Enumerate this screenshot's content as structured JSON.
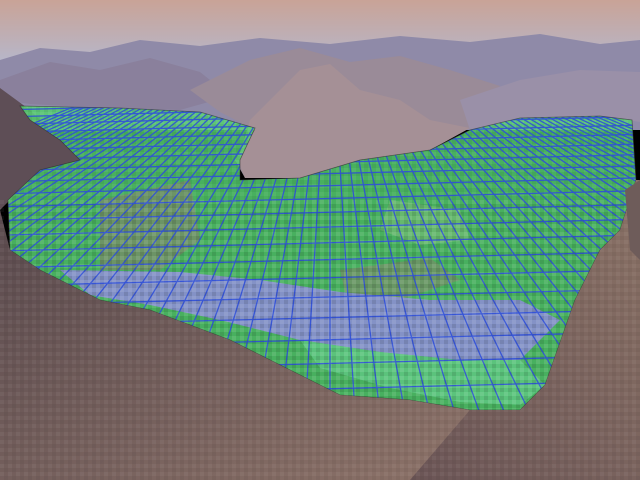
{
  "scene": {
    "sky_colors": {
      "top": "#c9a397",
      "bottom": "#b7b6c8"
    },
    "mountain_colors": {
      "far": "#8a86a6",
      "mid": "#9a8c9e",
      "near_dark": "#5a4a4e",
      "near_light": "#8d7369"
    },
    "terrain_overlay": {
      "fill_color": "#53d36a",
      "fill_opacity": 0.55,
      "grid_color": "#2f4fd8",
      "water_color": "#8a8fd0",
      "mesh_style": "perspective wireframe grid"
    },
    "foreground_colors": {
      "left": "#6b5556",
      "right": "#7b6559"
    }
  }
}
